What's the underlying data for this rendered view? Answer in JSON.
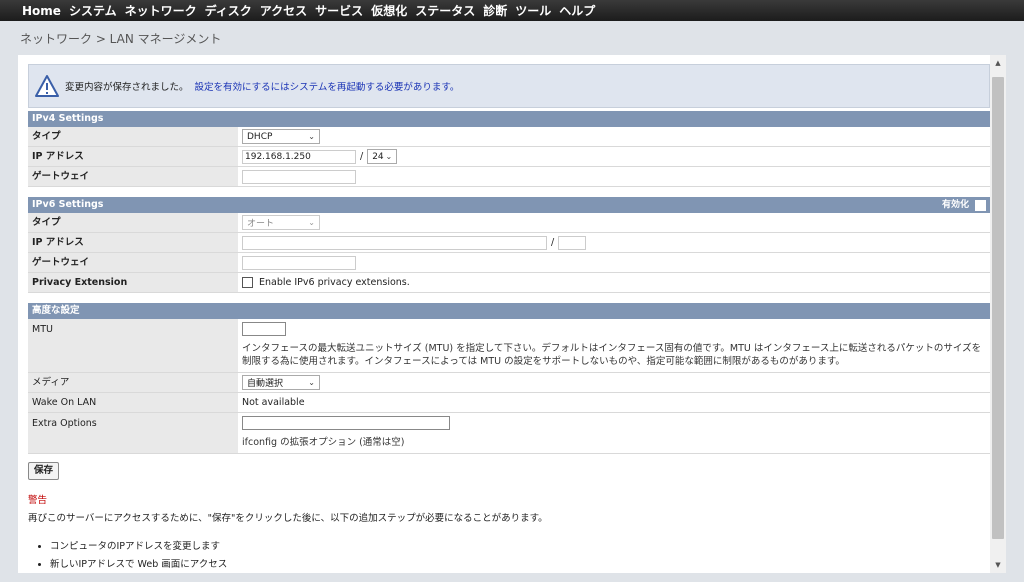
{
  "nav": [
    "Home",
    "システム",
    "ネットワーク",
    "ディスク",
    "アクセス",
    "サービス",
    "仮想化",
    "ステータス",
    "診断",
    "ツール",
    "ヘルプ"
  ],
  "breadcrumb": "ネットワーク > LAN マネージメント",
  "notice": {
    "message": "変更内容が保存されました。",
    "link": "設定を有効にするにはシステムを再起動する必要があります。"
  },
  "ipv4": {
    "heading": "IPv4 Settings",
    "type_label": "タイプ",
    "type_value": "DHCP",
    "ip_label": "IP アドレス",
    "ip_value": "192.168.1.250",
    "slash": "/",
    "mask_value": "24",
    "gateway_label": "ゲートウェイ"
  },
  "ipv6": {
    "heading": "IPv6 Settings",
    "enable_label": "有効化",
    "type_label": "タイプ",
    "type_value": "オート",
    "ip_label": "IP アドレス",
    "slash": "/",
    "gateway_label": "ゲートウェイ",
    "privacy_label": "Privacy Extension",
    "privacy_text": "Enable IPv6 privacy extensions."
  },
  "advanced": {
    "heading": "高度な設定",
    "mtu_label": "MTU",
    "mtu_help": "インタフェースの最大転送ユニットサイズ (MTU) を指定して下さい。デフォルトはインタフェース固有の値です。MTU はインタフェース上に転送されるパケットのサイズを制限する為に使用されます。インタフェースによっては MTU の設定をサポートしないものや、指定可能な範囲に制限があるものがあります。",
    "media_label": "メディア",
    "media_value": "自動選択",
    "wol_label": "Wake On LAN",
    "wol_value": "Not available",
    "extra_label": "Extra Options",
    "extra_help": "ifconfig の拡張オプション (通常は空)"
  },
  "save_label": "保存",
  "warning": {
    "title": "警告",
    "text": "再びこのサーバーにアクセスするために、\"保存\"をクリックした後に、以下の追加ステップが必要になることがあります。",
    "steps": [
      "コンピュータのIPアドレスを変更します",
      "新しいIPアドレスで Web 画面にアクセス"
    ]
  }
}
